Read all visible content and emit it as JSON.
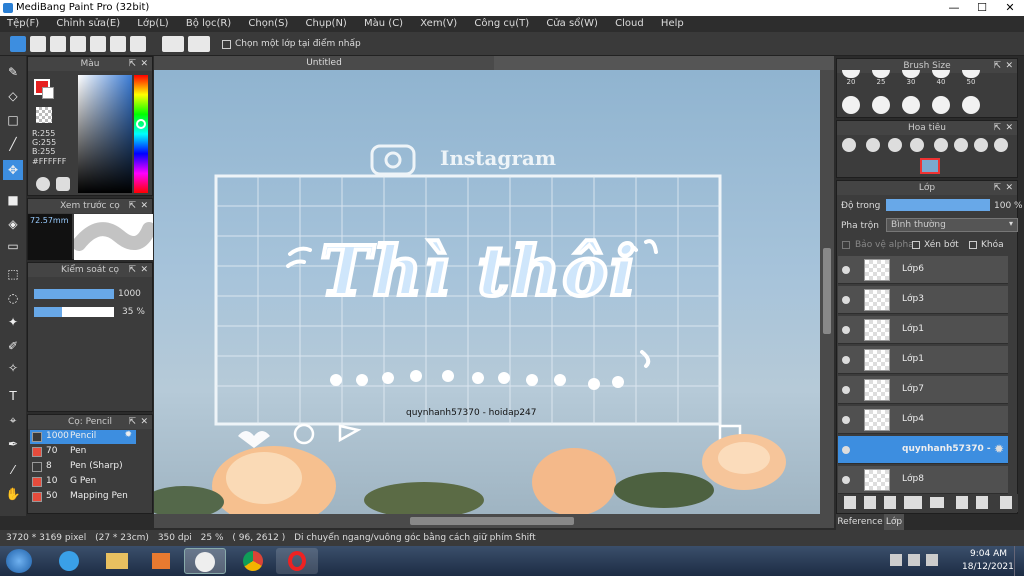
{
  "window": {
    "title": "MediBang Paint Pro (32bit)",
    "minimize": "—",
    "maximize": "☐",
    "close": "✕"
  },
  "menu": [
    "Tệp(F)",
    "Chỉnh sửa(E)",
    "Lớp(L)",
    "Bộ lọc(R)",
    "Chọn(S)",
    "Chụp(N)",
    "Màu (C)",
    "Xem(V)",
    "Công cụ(T)",
    "Cửa sổ(W)",
    "Cloud",
    "Help"
  ],
  "toolbar": {
    "checkbox_label": "Chọn một lớp tại điểm nhấp"
  },
  "color_panel": {
    "title": "Màu",
    "r": "R:255",
    "g": "G:255",
    "b": "B:255",
    "hex": "#FFFFFF"
  },
  "brush_preview": {
    "title": "Xem trước cọ",
    "size": "72.57mm"
  },
  "brush_control": {
    "title": "Kiểm soát cọ",
    "size_value": "1000",
    "opacity_value": "35 %",
    "opacity_fraction": 0.35
  },
  "brush_list": {
    "title": "Cọ: Pencil",
    "items": [
      {
        "num": "1000",
        "name": "Pencil",
        "color": "#3a3a3a"
      },
      {
        "num": "70",
        "name": "Pen",
        "color": "#e74c3c"
      },
      {
        "num": "8",
        "name": "Pen (Sharp)",
        "color": "#3a3a3a"
      },
      {
        "num": "10",
        "name": "G Pen",
        "color": "#e74c3c"
      },
      {
        "num": "50",
        "name": "Mapping Pen",
        "color": "#e74c3c"
      }
    ]
  },
  "canvas": {
    "tab": "Untitled",
    "instagram": "Instagram",
    "headline": "Thì thôi",
    "credit": "quynhanh57370 - hoidap247"
  },
  "brush_size_panel": {
    "title": "Brush Size",
    "sizes": [
      "20",
      "25",
      "30",
      "40",
      "50"
    ]
  },
  "navigator": {
    "title": "Hoa tiêu"
  },
  "layer_panel": {
    "title": "Lớp",
    "opacity_label": "Độ trong",
    "opacity_value": "100 %",
    "blend_label": "Pha trộn",
    "blend_value": "Bình thường",
    "protect_alpha": "Bảo vệ alpha",
    "clipping": "Xén bớt",
    "lock": "Khóa",
    "layers": [
      "Lớp6",
      "Lớp3",
      "Lớp1",
      "Lớp1",
      "Lớp7",
      "Lớp4",
      "quynhanh57370 - ",
      "Lớp8"
    ],
    "selected_index": 6
  },
  "bottom_tabs": [
    "Reference",
    "Lớp"
  ],
  "status": {
    "size": "3720 * 3169 pixel",
    "cm": "(27 * 23cm)",
    "dpi": "350 dpi",
    "zoom": "25 %",
    "coords": "( 96, 2612 )",
    "hint": "Di chuyển ngang/vuông góc bằng cách giữ phím Shift"
  },
  "taskbar": {
    "time": "9:04 AM",
    "date": "18/12/2021"
  },
  "colors": {
    "accent": "#3d8ee0",
    "primary": "#e62020"
  }
}
